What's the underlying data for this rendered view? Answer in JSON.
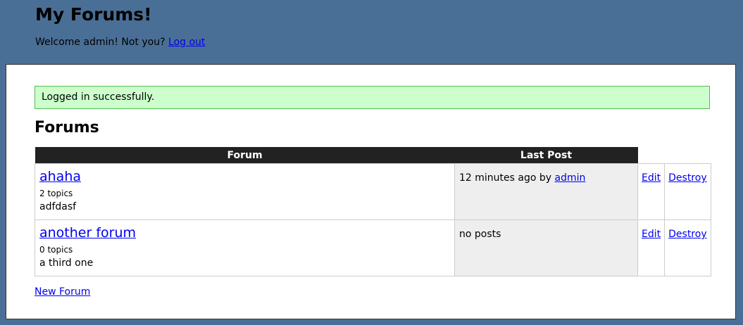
{
  "header": {
    "title": "My Forums!",
    "welcome_prefix": "Welcome admin! Not you?",
    "logout_label": "Log out"
  },
  "flash": {
    "message": "Logged in successfully."
  },
  "main": {
    "section_title": "Forums",
    "columns": [
      "Forum",
      "Last Post"
    ],
    "forums": [
      {
        "name": "ahaha",
        "topics": "2 topics",
        "description": "adfdasf",
        "last_post_prefix": "12 minutes ago by",
        "last_post_user": "admin",
        "edit_label": "Edit",
        "destroy_label": "Destroy"
      },
      {
        "name": "another forum",
        "topics": "0 topics",
        "description": "a third one",
        "last_post_prefix": "no posts",
        "last_post_user": "",
        "edit_label": "Edit",
        "destroy_label": "Destroy"
      }
    ],
    "new_forum_label": "New Forum"
  }
}
